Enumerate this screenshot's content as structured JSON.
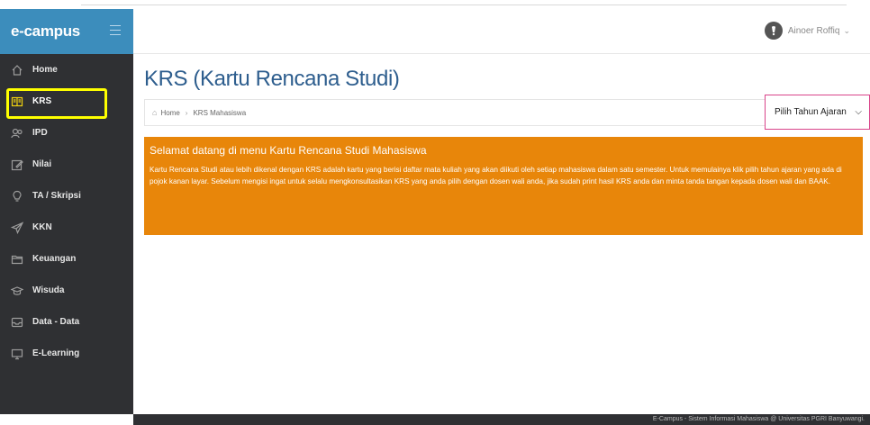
{
  "brand": {
    "name": "e-campus"
  },
  "user": {
    "name": "Ainoer Roffiq"
  },
  "sidebar": {
    "items": [
      {
        "label": "Home",
        "icon": "home-icon"
      },
      {
        "label": "KRS",
        "icon": "book-icon",
        "active": true
      },
      {
        "label": "IPD",
        "icon": "users-icon"
      },
      {
        "label": "Nilai",
        "icon": "pencil-icon"
      },
      {
        "label": "TA / Skripsi",
        "icon": "bulb-icon"
      },
      {
        "label": "KKN",
        "icon": "send-icon"
      },
      {
        "label": "Keuangan",
        "icon": "folder-icon"
      },
      {
        "label": "Wisuda",
        "icon": "graduation-cap-icon"
      },
      {
        "label": "Data - Data",
        "icon": "tray-icon"
      },
      {
        "label": "E-Learning",
        "icon": "monitor-icon"
      }
    ]
  },
  "page": {
    "title": "KRS (Kartu Rencana Studi)",
    "breadcrumb": [
      "Home",
      "KRS Mahasiswa"
    ],
    "select": {
      "selected": "Pilih Tahun Ajaran"
    }
  },
  "notice": {
    "title": "Selamat datang di menu Kartu Rencana Studi Mahasiswa",
    "body": "Kartu Rencana Studi atau lebih dikenal dengan KRS adalah kartu yang berisi daftar mata kuliah yang akan diikuti oleh setiap mahasiswa dalam satu semester. Untuk memulainya klik pilih tahun ajaran yang ada di pojok kanan layar. Sebelum mengisi ingat untuk selalu mengkonsultasikan KRS yang anda pilih dengan dosen wali anda, jika sudah print hasil KRS anda dan minta tanda tangan kepada dosen wali dan BAAK."
  },
  "footer": {
    "text": "E-Campus - Sistem Informasi Mahasiswa @ Universitas PGRI Banyuwangi."
  },
  "colors": {
    "sidebar": "#2f3033",
    "brand": "#3c8dbc",
    "notice": "#e8860a",
    "title": "#2e5e8e",
    "highlight": "#ffff00"
  }
}
